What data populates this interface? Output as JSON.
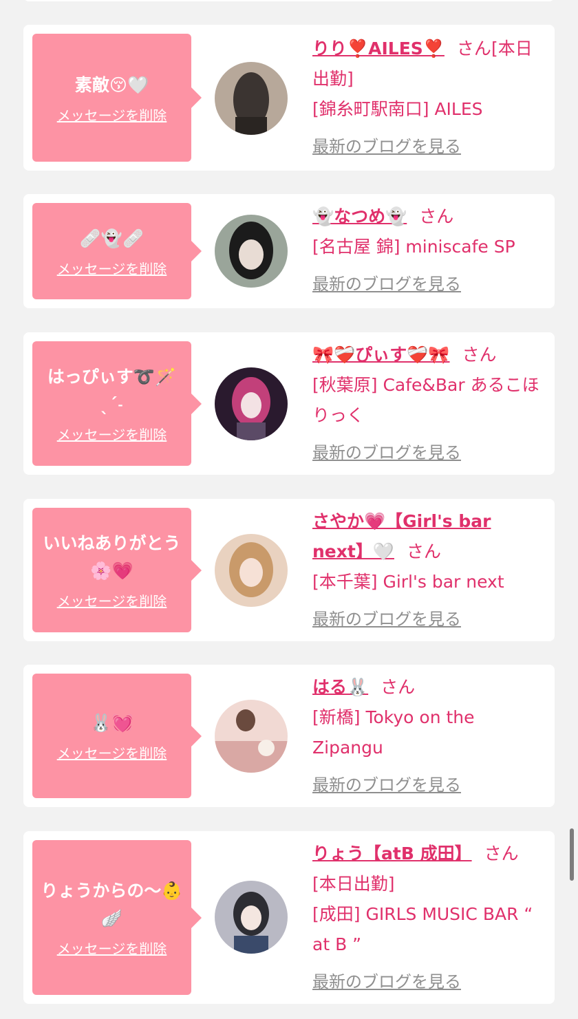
{
  "cards": [
    {
      "bubble_message": "素敵😚🤍",
      "delete_label": "メッセージを削除",
      "name": "りり❣️AILES❣️",
      "honorific": "さん",
      "status": "[本日出勤]",
      "shop": "[錦糸町駅南口] AILES",
      "blog_link": "最新のブログを見る",
      "avatar_colors": [
        "#3b3431",
        "#b7a89a"
      ]
    },
    {
      "bubble_message": "🩹👻🩹",
      "delete_label": "メッセージを削除",
      "name": "👻なつめ👻",
      "honorific": "さん",
      "status": "",
      "shop": "[名古屋 錦] miniscafe SP",
      "blog_link": "最新のブログを見る",
      "avatar_colors": [
        "#1b1b1b",
        "#9aa59a"
      ]
    },
    {
      "bubble_message": "はっぴぃす➰🪄 ˎˊ˗",
      "delete_label": "メッセージを削除",
      "name": "🎀❤️‍🩹ぴぃす❤️‍🩹🎀",
      "honorific": "さん",
      "status": "",
      "shop": "[秋葉原] Cafe&Bar あるこほりっく",
      "blog_link": "最新のブログを見る",
      "avatar_colors": [
        "#2a1a2e",
        "#c2407a"
      ]
    },
    {
      "bubble_message": "いいねありがとう🌸💗",
      "delete_label": "メッセージを削除",
      "name": "さやか💗【Girl's bar next】🤍",
      "honorific": "さん",
      "status": "",
      "shop": "[本千葉] Girl's bar next",
      "blog_link": "最新のブログを見る",
      "avatar_colors": [
        "#c99a6a",
        "#e9d2c0"
      ]
    },
    {
      "bubble_message": "🐰💓",
      "delete_label": "メッセージを削除",
      "name": "はる🐰",
      "honorific": "さん",
      "status": "",
      "shop": "[新橋] Tokyo on the Zipangu",
      "blog_link": "最新のブログを見る",
      "avatar_colors": [
        "#d9a8a4",
        "#f1d9d3"
      ]
    },
    {
      "bubble_message": "りょうからの〜👶🪽",
      "delete_label": "メッセージを削除",
      "name": "りょう【atB 成田】",
      "honorific": "さん",
      "status": "[本日出勤]",
      "shop": "[成田] GIRLS MUSIC BAR “ at B ”",
      "blog_link": "最新のブログを見る",
      "avatar_colors": [
        "#2d2d33",
        "#b9b9c4"
      ]
    }
  ]
}
